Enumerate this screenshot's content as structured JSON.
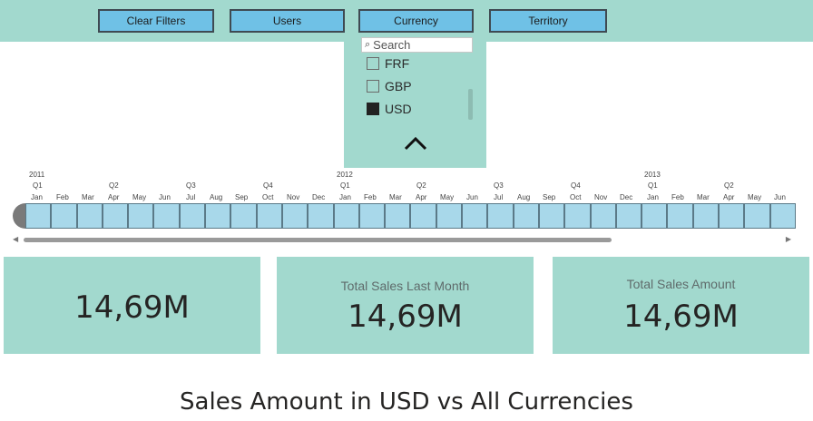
{
  "filters": {
    "clear_label": "Clear Filters",
    "users_label": "Users",
    "currency_label": "Currency",
    "territory_label": "Territory"
  },
  "currency_dropdown": {
    "search_placeholder": "Search",
    "options": [
      {
        "label": "FRF",
        "checked": false
      },
      {
        "label": "GBP",
        "checked": false
      },
      {
        "label": "USD",
        "checked": true
      }
    ]
  },
  "timeline": {
    "years": [
      "2011",
      "2012",
      "2013"
    ],
    "quarters": [
      "Q1",
      "Q2",
      "Q3",
      "Q4",
      "Q1",
      "Q2",
      "Q3",
      "Q4",
      "Q1",
      "Q2"
    ],
    "months": [
      "Jan",
      "Feb",
      "Mar",
      "Apr",
      "May",
      "Jun",
      "Jul",
      "Aug",
      "Sep",
      "Oct",
      "Nov",
      "Dec",
      "Jan",
      "Feb",
      "Mar",
      "Apr",
      "May",
      "Jun",
      "Jul",
      "Aug",
      "Sep",
      "Oct",
      "Nov",
      "Dec",
      "Jan",
      "Feb",
      "Mar",
      "Apr",
      "May",
      "Jun"
    ]
  },
  "cards": [
    {
      "title": "",
      "value": "14,69M"
    },
    {
      "title": "Total Sales Last Month",
      "value": "14,69M"
    },
    {
      "title": "Total Sales Amount",
      "value": "14,69M"
    }
  ],
  "chart_title": "Sales Amount in USD vs All Currencies",
  "colors": {
    "band": "#a2d9ce",
    "button": "#6fc1e6",
    "timeline_cell": "#a8d8ea"
  }
}
